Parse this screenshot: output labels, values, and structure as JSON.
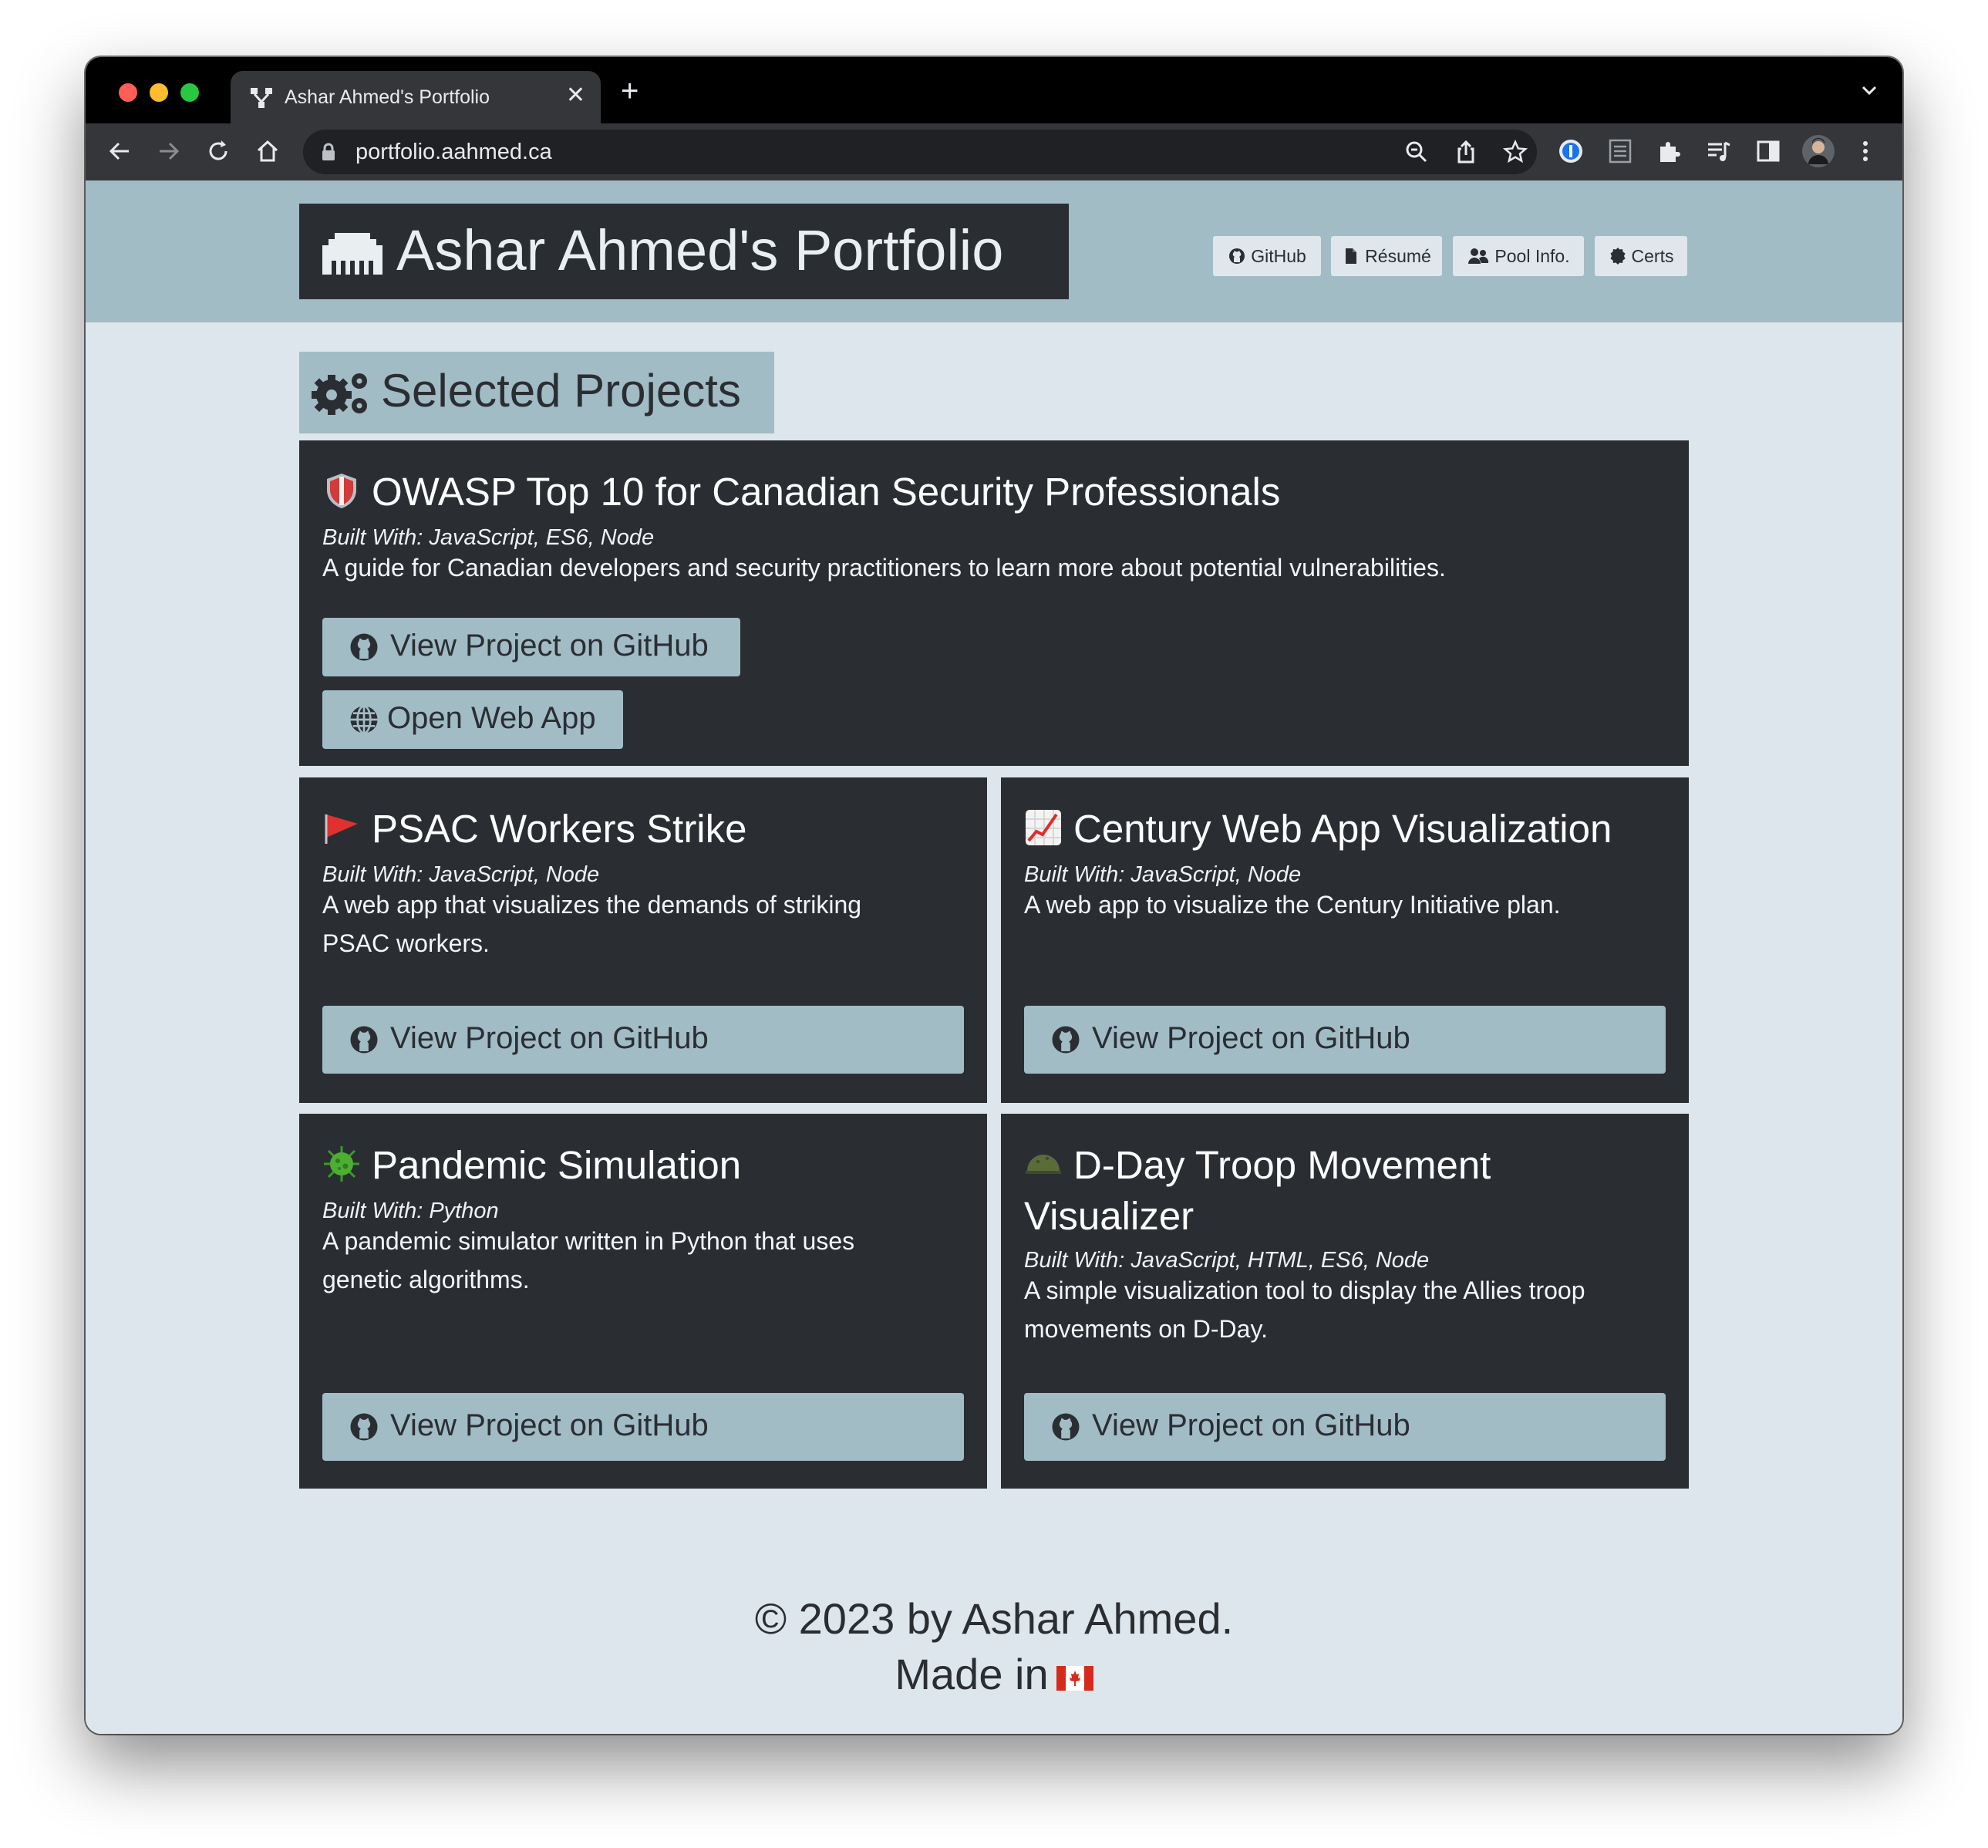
{
  "browser": {
    "tab_title": "Ashar Ahmed's Portfolio",
    "url": "portfolio.aahmed.ca",
    "icons": [
      "back-icon",
      "forward-icon",
      "reload-icon",
      "home-icon",
      "lock-icon",
      "zoom-icon",
      "share-icon",
      "bookmark-star-icon",
      "password-manager-icon",
      "reader-icon",
      "extensions-icon",
      "media-icon",
      "sidepanel-icon",
      "profile-avatar",
      "kebab-menu-icon"
    ]
  },
  "header": {
    "brand": "Ashar Ahmed's Portfolio",
    "nav": [
      {
        "label": "GitHub",
        "icon": "github-icon"
      },
      {
        "label": "Résumé",
        "icon": "file-icon"
      },
      {
        "label": "Pool Info.",
        "icon": "users-icon"
      },
      {
        "label": "Certs",
        "icon": "certificate-icon"
      }
    ]
  },
  "section": {
    "title": "Selected Projects",
    "icon": "gears-icon"
  },
  "projects": [
    {
      "emoji": "shield",
      "title": "OWASP Top 10 for Canadian Security Professionals",
      "built": "Built With: JavaScript, ES6, Node",
      "desc": "A guide for Canadian developers and security practitioners to learn more about potential vulnerabilities.",
      "buttons": [
        "View Project on GitHub",
        "Open Web App"
      ]
    },
    {
      "emoji": "red-flag",
      "title": "PSAC Workers Strike",
      "built": "Built With: JavaScript, Node",
      "desc_lines": [
        "A web app that visualizes the demands of striking",
        "PSAC workers."
      ],
      "buttons": [
        "View Project on GitHub"
      ]
    },
    {
      "emoji": "chart-increasing",
      "title": "Century Web App Visualization",
      "built": "Built With: JavaScript, Node",
      "desc": "A web app to visualize the Century Initiative plan.",
      "buttons": [
        "View Project on GitHub"
      ]
    },
    {
      "emoji": "microbe",
      "title": "Pandemic Simulation",
      "built": "Built With: Python",
      "desc_lines": [
        "A pandemic simulator written in Python that uses",
        "genetic algorithms."
      ],
      "buttons": [
        "View Project on GitHub"
      ]
    },
    {
      "emoji": "military-helmet",
      "title_lines": [
        "D-Day Troop Movement",
        "Visualizer"
      ],
      "built": "Built With: JavaScript, HTML, ES6, Node",
      "desc_lines": [
        "A simple visualization tool to display the Allies troop",
        "movements on D-Day."
      ],
      "buttons": [
        "View Project on GitHub"
      ]
    }
  ],
  "footer": {
    "line1": "© 2023 by Ashar Ahmed.",
    "line2": "Made in",
    "flag": "canada-flag"
  },
  "colors": {
    "header_bg": "#a2bcc6",
    "page_bg": "#dde6ec",
    "card_bg": "#2a2e33",
    "button_bg": "#a2bcc6"
  }
}
